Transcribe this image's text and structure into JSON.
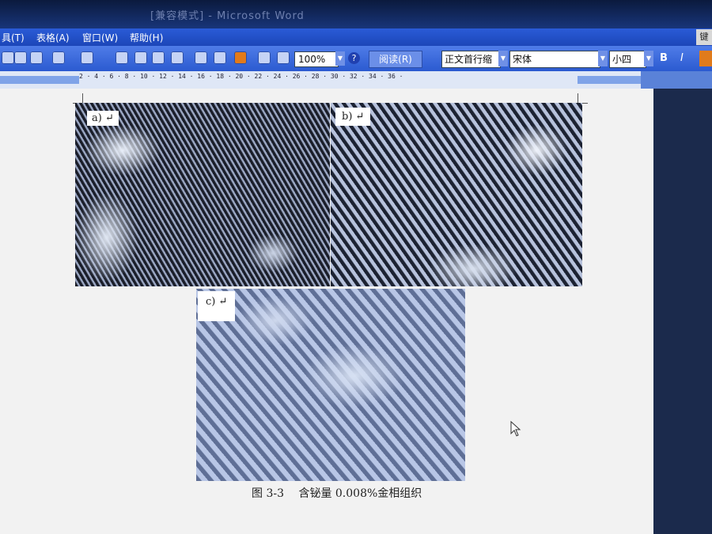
{
  "window": {
    "title": "[兼容模式] - Microsoft Word"
  },
  "menu": {
    "items": [
      "具(T)",
      "表格(A)",
      "窗口(W)",
      "帮助(H)"
    ],
    "right_button": "键"
  },
  "toolbar": {
    "zoom": "100%",
    "reading_label": "阅读(R)",
    "style": "正文首行缩",
    "font": "宋体",
    "size": "小四",
    "bold": "B",
    "italic": "I"
  },
  "ruler": {
    "ticks": "2 · 4 · 6 · 8 · 10 · 12 · 14 · 16 · 18 · 20 · 22 · 24 · 26 · 28 · 30 · 32 · 34 · 36 ·"
  },
  "document": {
    "figures": [
      {
        "label": "a) ↵"
      },
      {
        "label": "b) ↵"
      },
      {
        "label": "c) ↵"
      }
    ],
    "caption": "图 3-3　 含铋量 0.008%金相组织"
  },
  "colors": {
    "titlebar": "#0b1a3d",
    "menubar": "#2a5bd7",
    "toolbar": "#4f7ce8",
    "page": "#f2f2f2"
  }
}
